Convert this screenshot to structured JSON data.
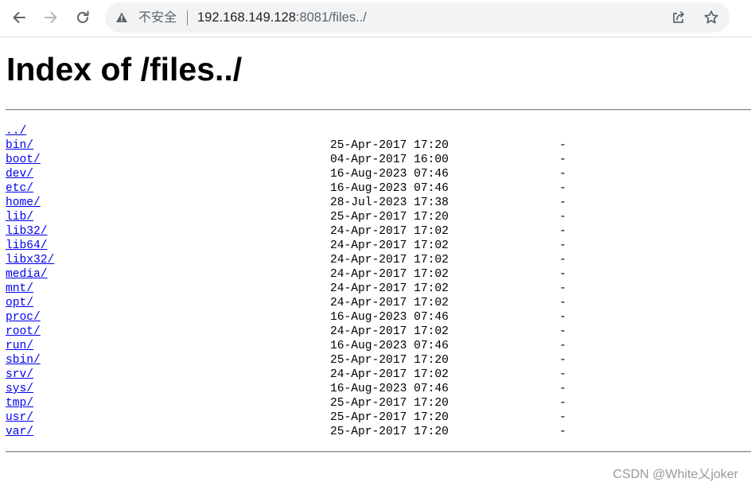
{
  "browser": {
    "security_label": "不安全",
    "url_host": "192.168.149.128",
    "url_rest": ":8081/files../",
    "icons": [
      "back-arrow-icon",
      "forward-arrow-icon",
      "reload-icon",
      "warning-triangle-icon",
      "share-icon",
      "star-icon"
    ]
  },
  "page": {
    "title": "Index of /files../",
    "parent_link": "../",
    "entries": [
      {
        "name": "bin/",
        "date": "25-Apr-2017 17:20",
        "size": "-"
      },
      {
        "name": "boot/",
        "date": "04-Apr-2017 16:00",
        "size": "-"
      },
      {
        "name": "dev/",
        "date": "16-Aug-2023 07:46",
        "size": "-"
      },
      {
        "name": "etc/",
        "date": "16-Aug-2023 07:46",
        "size": "-"
      },
      {
        "name": "home/",
        "date": "28-Jul-2023 17:38",
        "size": "-"
      },
      {
        "name": "lib/",
        "date": "25-Apr-2017 17:20",
        "size": "-"
      },
      {
        "name": "lib32/",
        "date": "24-Apr-2017 17:02",
        "size": "-"
      },
      {
        "name": "lib64/",
        "date": "24-Apr-2017 17:02",
        "size": "-"
      },
      {
        "name": "libx32/",
        "date": "24-Apr-2017 17:02",
        "size": "-"
      },
      {
        "name": "media/",
        "date": "24-Apr-2017 17:02",
        "size": "-"
      },
      {
        "name": "mnt/",
        "date": "24-Apr-2017 17:02",
        "size": "-"
      },
      {
        "name": "opt/",
        "date": "24-Apr-2017 17:02",
        "size": "-"
      },
      {
        "name": "proc/",
        "date": "16-Aug-2023 07:46",
        "size": "-"
      },
      {
        "name": "root/",
        "date": "24-Apr-2017 17:02",
        "size": "-"
      },
      {
        "name": "run/",
        "date": "16-Aug-2023 07:46",
        "size": "-"
      },
      {
        "name": "sbin/",
        "date": "25-Apr-2017 17:20",
        "size": "-"
      },
      {
        "name": "srv/",
        "date": "24-Apr-2017 17:02",
        "size": "-"
      },
      {
        "name": "sys/",
        "date": "16-Aug-2023 07:46",
        "size": "-"
      },
      {
        "name": "tmp/",
        "date": "25-Apr-2017 17:20",
        "size": "-"
      },
      {
        "name": "usr/",
        "date": "25-Apr-2017 17:20",
        "size": "-"
      },
      {
        "name": "var/",
        "date": "25-Apr-2017 17:20",
        "size": "-"
      }
    ]
  },
  "watermark": "CSDN @White乂joker",
  "colors": {
    "link": "#0000ee",
    "omnibox_bg": "#f1f3f4",
    "icon": "#5f6368"
  }
}
